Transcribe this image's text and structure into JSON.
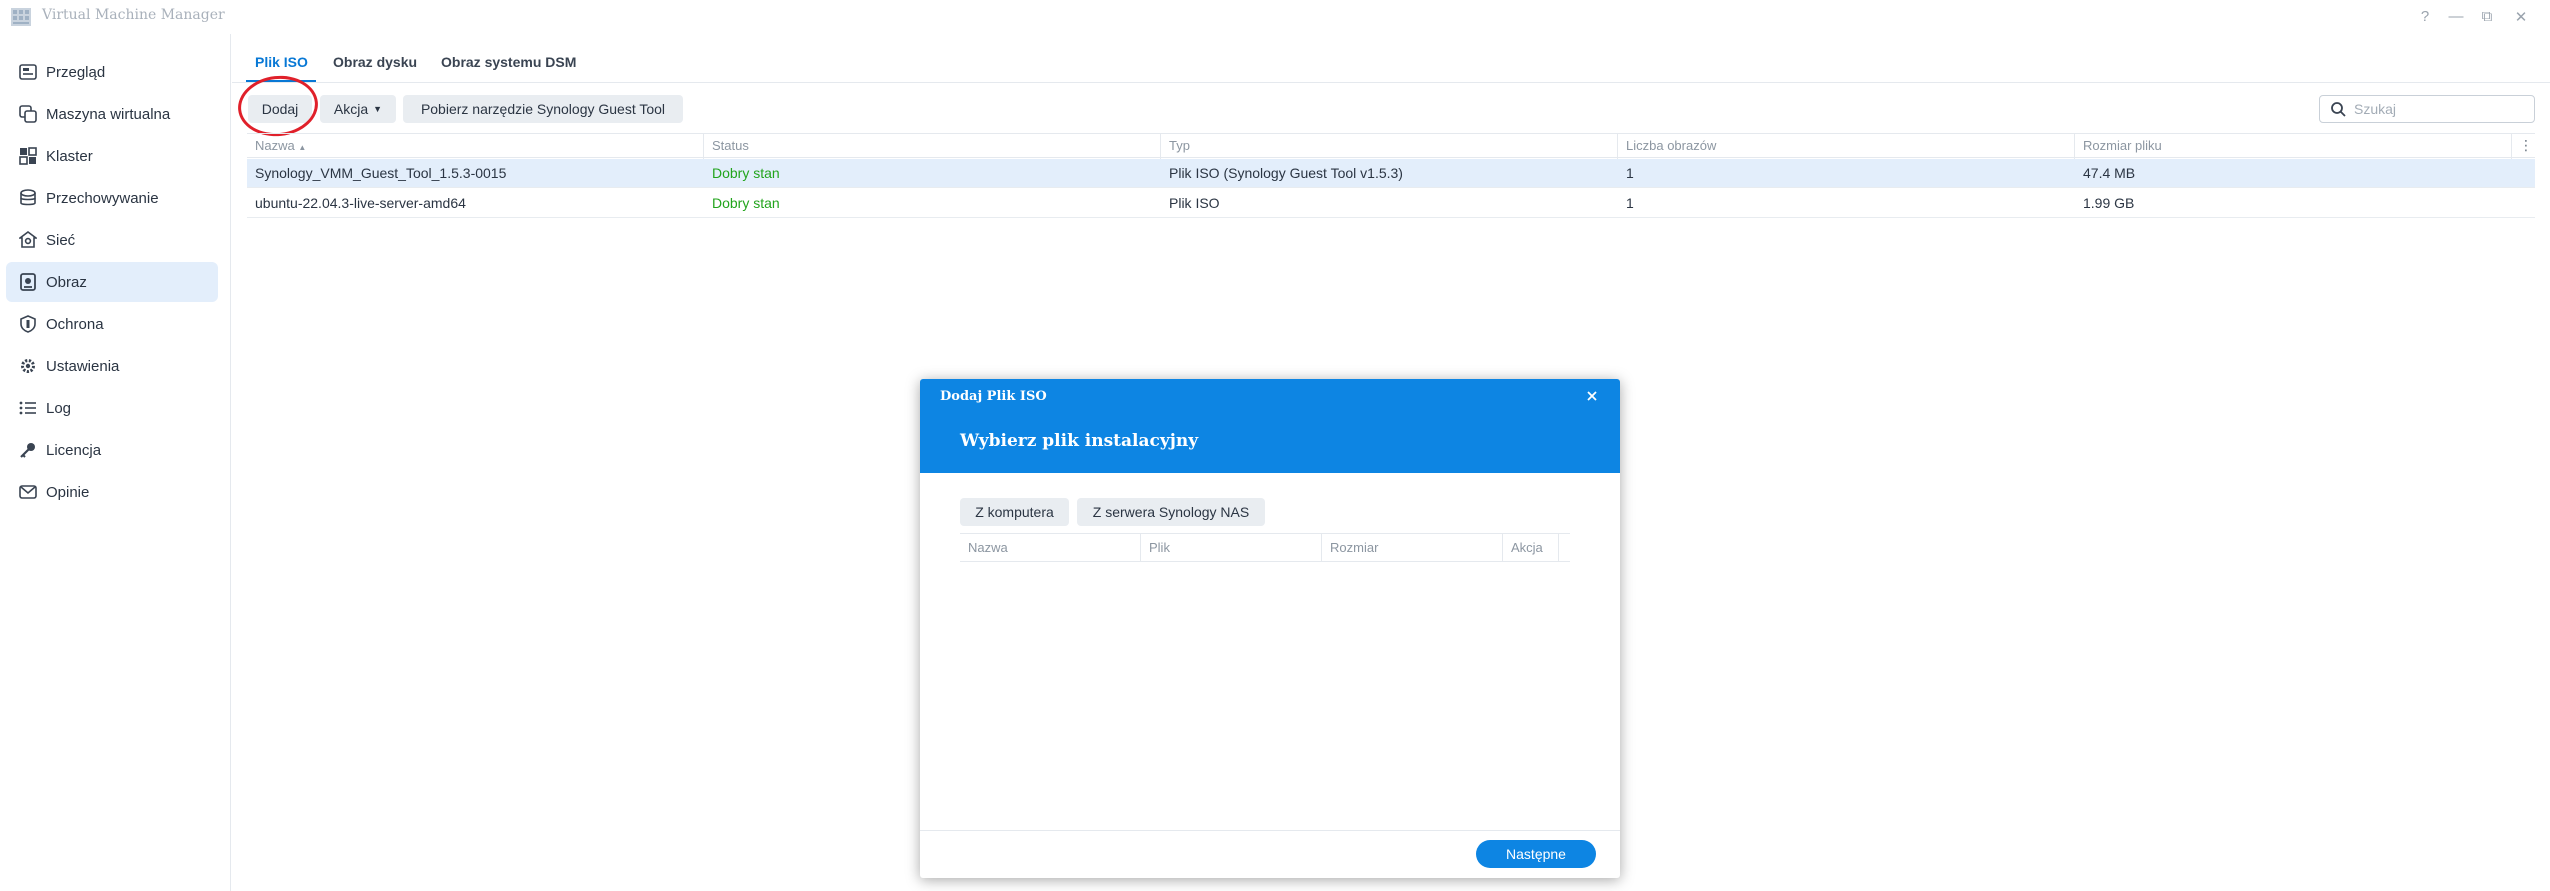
{
  "window": {
    "title": "Virtual Machine Manager",
    "controls": [
      "?",
      "—",
      "⧉",
      "✕"
    ]
  },
  "sidebar": {
    "items": [
      {
        "label": "Przegląd",
        "icon": "overview-icon"
      },
      {
        "label": "Maszyna wirtualna",
        "icon": "virtual-machine-icon"
      },
      {
        "label": "Klaster",
        "icon": "cluster-icon"
      },
      {
        "label": "Przechowywanie",
        "icon": "storage-icon"
      },
      {
        "label": "Sieć",
        "icon": "network-icon"
      },
      {
        "label": "Obraz",
        "icon": "image-icon",
        "active": true
      },
      {
        "label": "Ochrona",
        "icon": "shield-icon"
      },
      {
        "label": "Ustawienia",
        "icon": "gear-icon"
      },
      {
        "label": "Log",
        "icon": "log-list-icon"
      },
      {
        "label": "Licencja",
        "icon": "key-icon"
      },
      {
        "label": "Opinie",
        "icon": "feedback-mail-icon"
      }
    ]
  },
  "tabs": [
    {
      "label": "Plik ISO",
      "active": true
    },
    {
      "label": "Obraz dysku"
    },
    {
      "label": "Obraz systemu DSM"
    }
  ],
  "toolbar": {
    "add_label": "Dodaj",
    "action_label": "Akcja",
    "download_label": "Pobierz narzędzie Synology Guest Tool",
    "search_placeholder": "Szukaj"
  },
  "table": {
    "columns": [
      "Nazwa",
      "Status",
      "Typ",
      "Liczba obrazów",
      "Rozmiar pliku"
    ],
    "rows": [
      [
        "Synology_VMM_Guest_Tool_1.5.3-0015",
        "Dobry stan",
        "Plik ISO (Synology Guest Tool v1.5.3)",
        "1",
        "47.4 MB"
      ],
      [
        "ubuntu-22.04.3-live-server-amd64",
        "Dobry stan",
        "Plik ISO",
        "1",
        "1.99 GB"
      ]
    ]
  },
  "dialog": {
    "small_title": "Dodaj Plik ISO",
    "title": "Wybierz plik instalacyjny",
    "from_computer_label": "Z komputera",
    "from_nas_label": "Z serwera Synology NAS",
    "columns": [
      "Nazwa",
      "Plik",
      "Rozmiar",
      "Akcja"
    ],
    "next_label": "Następne"
  },
  "colors": {
    "accent": "#0d85e3",
    "status_ok": "#22a41c",
    "annotation_circle": "#e0202a"
  }
}
